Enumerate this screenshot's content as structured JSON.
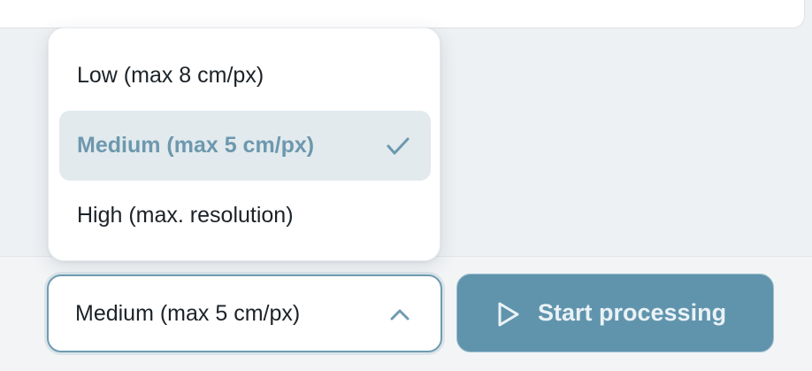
{
  "resolution_select": {
    "selected_value": "Medium (max 5 cm/px)",
    "expanded": true,
    "options": [
      {
        "label": "Low (max 8 cm/px)",
        "selected": false
      },
      {
        "label": "Medium (max 5 cm/px)",
        "selected": true
      },
      {
        "label": "High (max. resolution)",
        "selected": false
      }
    ],
    "selected_icon": "checkmark-icon",
    "toggle_icon": "chevron-up-icon"
  },
  "start_button": {
    "label": "Start processing",
    "icon": "play-icon"
  },
  "colors": {
    "accent": "#6094ad",
    "selected_option_bg": "#e2eaee",
    "selected_option_text": "#6d98ad",
    "text": "#1c2227",
    "background": "#eef1f3"
  }
}
